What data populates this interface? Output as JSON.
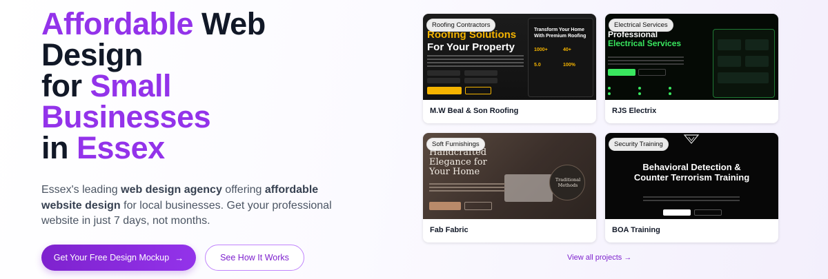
{
  "hero": {
    "headline": {
      "line1_accent": "Affordable",
      "line1_rest": " Web",
      "line2": "Design",
      "line3_pre": "for ",
      "line3_accent": "Small",
      "line4_accent": "Businesses",
      "line5_pre": "in ",
      "line5_accent": "Essex"
    },
    "subtext": {
      "p1": "Essex's leading ",
      "b1": "web design agency",
      "p2": " offering ",
      "b2": "affordable website design",
      "p3": " for local businesses. Get your professional website in just 7 days, not months."
    },
    "cta_primary": "Get Your Free Design Mockup",
    "cta_secondary": "See How It Works",
    "arrow": "→"
  },
  "portfolio": {
    "projects": [
      {
        "tag": "Roofing Contractors",
        "name": "M.W Beal & Son Roofing",
        "thumb_title_accent": "Roofing Solutions",
        "thumb_title": "For Your Property",
        "panel_title": "Transform Your Home With Premium Roofing",
        "stats": [
          "1000+",
          "40+",
          "5.0",
          "100%"
        ]
      },
      {
        "tag": "Electrical Services",
        "name": "RJS Electrix",
        "thumb_title": "Professional",
        "thumb_title_accent": "Electrical Services"
      },
      {
        "tag": "Soft Furnishings",
        "name": "Fab Fabric",
        "thumb_title": "Handcrafted Elegance for Your Home",
        "badge": "Traditional Methods"
      },
      {
        "tag": "Security Training",
        "name": "BOA Training",
        "thumb_title": "Behavioral Detection & Counter Terrorism Training"
      }
    ],
    "view_all": "View all projects →"
  },
  "colors": {
    "accent": "#9333ea",
    "roofing_gold": "#f5b400",
    "electric_green": "#39e75f"
  }
}
